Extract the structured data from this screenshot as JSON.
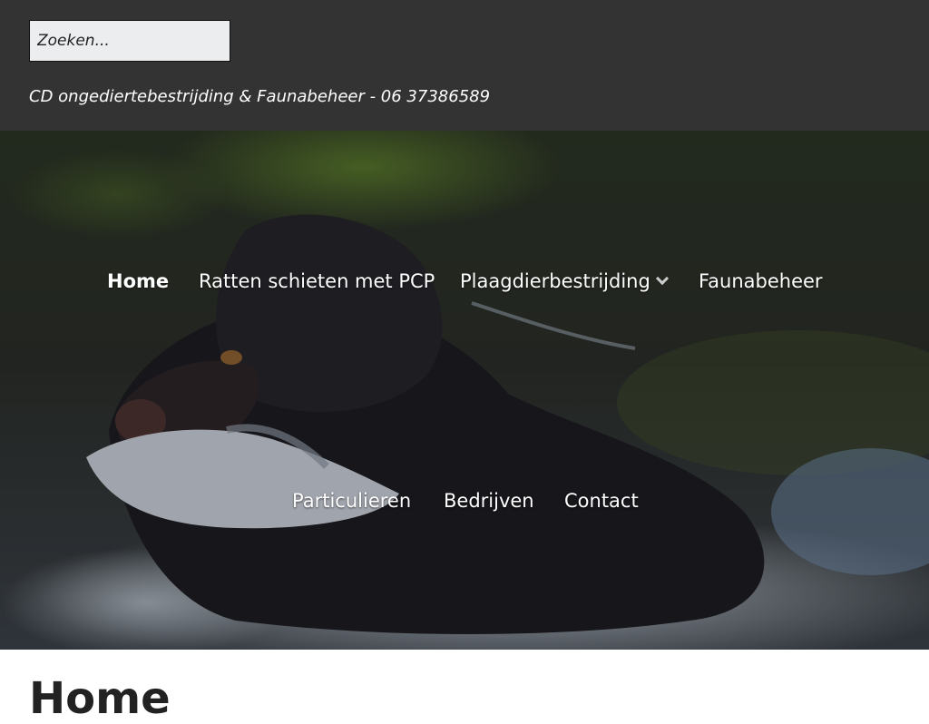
{
  "header": {
    "search": {
      "placeholder": "Zoeken..."
    },
    "tagline": "CD ongediertebestrijding & Faunabeheer - 06 37386589"
  },
  "hero": {
    "nav": {
      "home": "Home",
      "ratten": "Ratten schieten met PCP",
      "plaagdier": "Plaagdierbestrijding",
      "fauna": "Faunabeheer",
      "particulieren": "Particulieren",
      "bedrijven": "Bedrijven",
      "contact": "Contact"
    },
    "dropdown_icon": "chevron-down"
  },
  "main": {
    "title": "Home"
  },
  "colors": {
    "topbar": "#333333",
    "search_bg": "#ecedef",
    "nav_text": "#ffffff",
    "title_text": "#222222"
  }
}
